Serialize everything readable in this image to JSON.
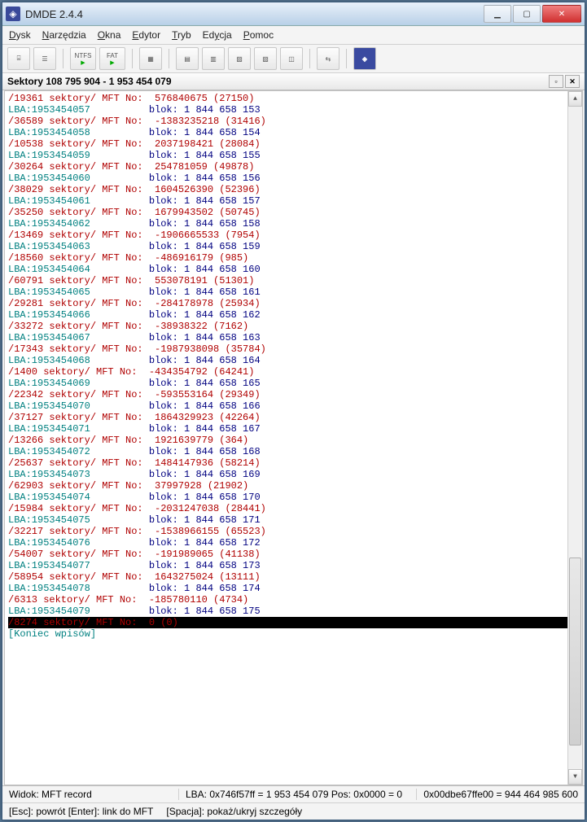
{
  "window": {
    "title": "DMDE 2.4.4"
  },
  "menu": {
    "items": [
      "Dysk",
      "Narzędzia",
      "Okna",
      "Edytor",
      "Tryb",
      "Edycja",
      "Pomoc"
    ]
  },
  "toolbar": {
    "ntfs_label": "NTFS",
    "fat_label": "FAT"
  },
  "panel": {
    "title": "Sektory 108 795 904 - 1 953 454 079"
  },
  "records": [
    {
      "sek": "/19361 sektory/ MFT No:  576840675 (27150)",
      "lba": "LBA:1953454057          blok: 1 844 658 153"
    },
    {
      "sek": "/36589 sektory/ MFT No:  -1383235218 (31416)",
      "lba": "LBA:1953454058          blok: 1 844 658 154"
    },
    {
      "sek": "/10538 sektory/ MFT No:  2037198421 (28084)",
      "lba": "LBA:1953454059          blok: 1 844 658 155"
    },
    {
      "sek": "/30264 sektory/ MFT No:  254781059 (49878)",
      "lba": "LBA:1953454060          blok: 1 844 658 156"
    },
    {
      "sek": "/38029 sektory/ MFT No:  1604526390 (52396)",
      "lba": "LBA:1953454061          blok: 1 844 658 157"
    },
    {
      "sek": "/35250 sektory/ MFT No:  1679943502 (50745)",
      "lba": "LBA:1953454062          blok: 1 844 658 158"
    },
    {
      "sek": "/13469 sektory/ MFT No:  -1906665533 (7954)",
      "lba": "LBA:1953454063          blok: 1 844 658 159"
    },
    {
      "sek": "/18560 sektory/ MFT No:  -486916179 (985)",
      "lba": "LBA:1953454064          blok: 1 844 658 160"
    },
    {
      "sek": "/60791 sektory/ MFT No:  553078191 (51301)",
      "lba": "LBA:1953454065          blok: 1 844 658 161"
    },
    {
      "sek": "/29281 sektory/ MFT No:  -284178978 (25934)",
      "lba": "LBA:1953454066          blok: 1 844 658 162"
    },
    {
      "sek": "/33272 sektory/ MFT No:  -38938322 (7162)",
      "lba": "LBA:1953454067          blok: 1 844 658 163"
    },
    {
      "sek": "/17343 sektory/ MFT No:  -1987938098 (35784)",
      "lba": "LBA:1953454068          blok: 1 844 658 164"
    },
    {
      "sek": "/1400 sektory/ MFT No:  -434354792 (64241)",
      "lba": "LBA:1953454069          blok: 1 844 658 165"
    },
    {
      "sek": "/22342 sektory/ MFT No:  -593553164 (29349)",
      "lba": "LBA:1953454070          blok: 1 844 658 166"
    },
    {
      "sek": "/37127 sektory/ MFT No:  1864329923 (42264)",
      "lba": "LBA:1953454071          blok: 1 844 658 167"
    },
    {
      "sek": "/13266 sektory/ MFT No:  1921639779 (364)",
      "lba": "LBA:1953454072          blok: 1 844 658 168"
    },
    {
      "sek": "/25637 sektory/ MFT No:  1484147936 (58214)",
      "lba": "LBA:1953454073          blok: 1 844 658 169"
    },
    {
      "sek": "/62903 sektory/ MFT No:  37997928 (21902)",
      "lba": "LBA:1953454074          blok: 1 844 658 170"
    },
    {
      "sek": "/15984 sektory/ MFT No:  -2031247038 (28441)",
      "lba": "LBA:1953454075          blok: 1 844 658 171"
    },
    {
      "sek": "/32217 sektory/ MFT No:  -1538966155 (65523)",
      "lba": "LBA:1953454076          blok: 1 844 658 172"
    },
    {
      "sek": "/54007 sektory/ MFT No:  -191989065 (41138)",
      "lba": "LBA:1953454077          blok: 1 844 658 173"
    },
    {
      "sek": "/58954 sektory/ MFT No:  1643275024 (13111)",
      "lba": "LBA:1953454078          blok: 1 844 658 174"
    },
    {
      "sek": "/6313 sektory/ MFT No:  -185780110 (4734)",
      "lba": "LBA:1953454079          blok: 1 844 658 175"
    }
  ],
  "selected_row": "/8274 sektory/ MFT No:  0 (0)",
  "end_label": "[Koniec wpisów]",
  "status": {
    "view": "Widok: MFT record",
    "pos": "LBA: 0x746f57ff = 1 953 454 079   Pos: 0x0000 = 0",
    "offset": "0x00dbe67ffe00 = 944 464 985 600",
    "hint1": "[Esc]: powrót [Enter]: link do MFT",
    "hint2": "[Spacja]: pokaż/ukryj szczegóły"
  }
}
